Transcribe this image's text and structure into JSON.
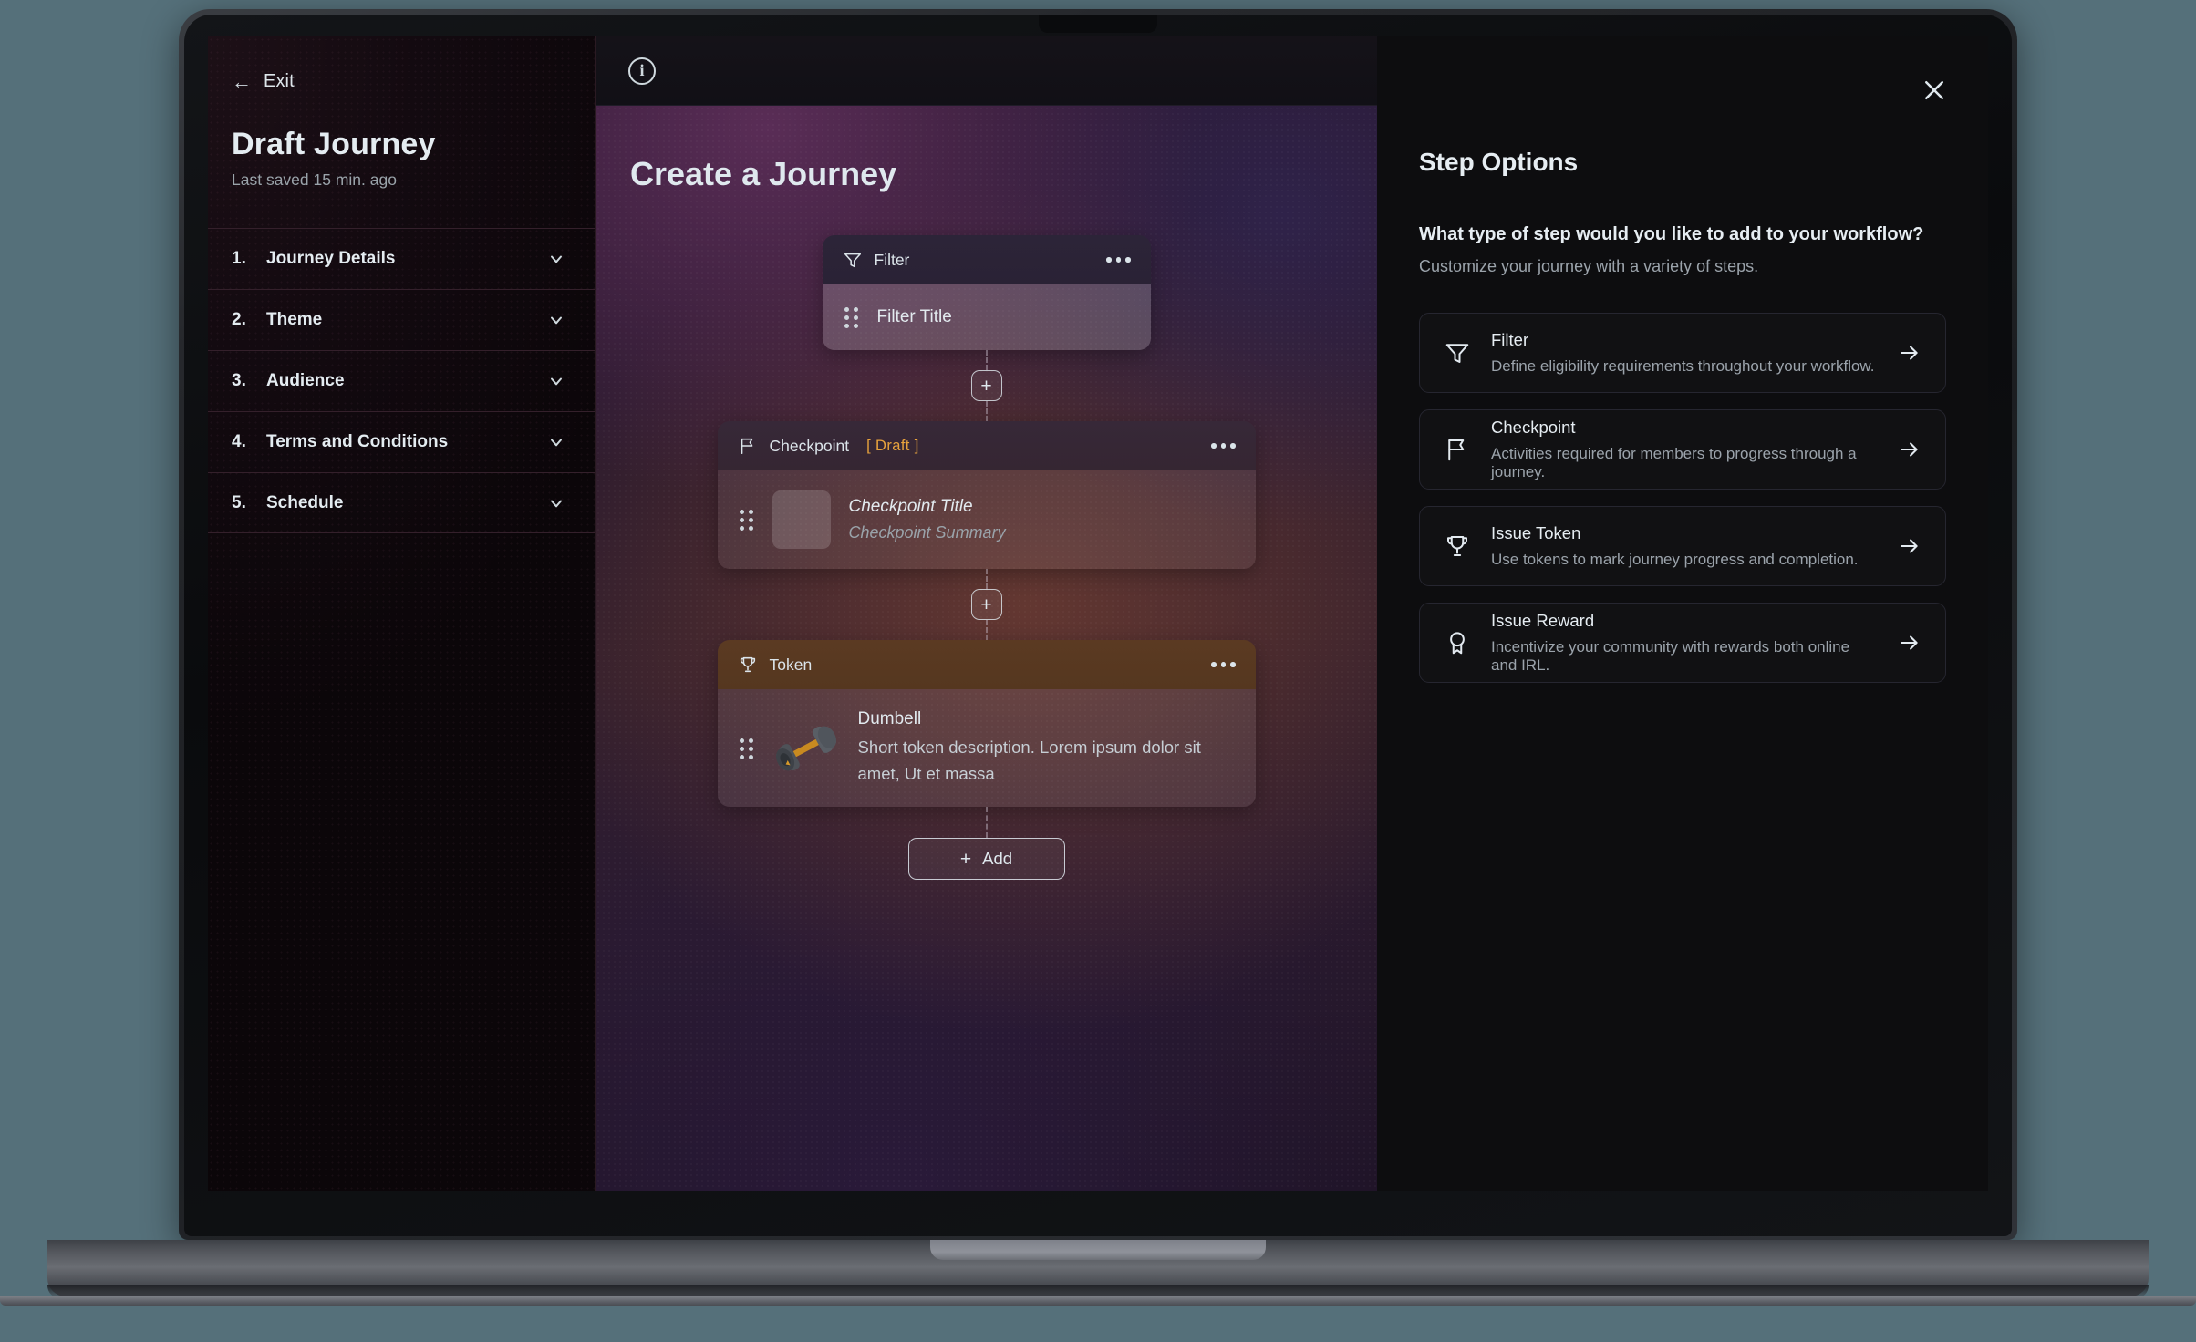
{
  "sidebar": {
    "exit_label": "Exit",
    "title": "Draft Journey",
    "last_saved": "Last saved 15 min. ago",
    "items": [
      {
        "num": "1.",
        "label": "Journey Details"
      },
      {
        "num": "2.",
        "label": "Theme"
      },
      {
        "num": "3.",
        "label": "Audience"
      },
      {
        "num": "4.",
        "label": "Terms and Conditions"
      },
      {
        "num": "5.",
        "label": "Schedule"
      }
    ]
  },
  "canvas": {
    "title": "Create a Journey",
    "add_button": "Add",
    "plus_label": "+",
    "steps": [
      {
        "kind": "filter",
        "head_label": "Filter",
        "badge": "",
        "item_title": "Filter Title"
      },
      {
        "kind": "checkpoint",
        "head_label": "Checkpoint",
        "badge": "[ Draft ]",
        "item_title": "Checkpoint Title",
        "item_sub": "Checkpoint Summary"
      },
      {
        "kind": "token",
        "head_label": "Token",
        "badge": "",
        "item_title": "Dumbell",
        "item_sub": "Short token description. Lorem ipsum dolor sit amet, Ut et massa"
      }
    ]
  },
  "right_panel": {
    "title": "Step Options",
    "question": "What type of step would you like to add to your workflow?",
    "subtitle": "Customize your journey with a variety of steps.",
    "options": [
      {
        "name": "Filter",
        "desc": "Define eligibility requirements throughout your workflow."
      },
      {
        "name": "Checkpoint",
        "desc": "Activities required for members to progress through a journey."
      },
      {
        "name": "Issue Token",
        "desc": "Use tokens to mark journey progress and completion."
      },
      {
        "name": "Issue Reward",
        "desc": "Incentivize your community with rewards both online and IRL."
      }
    ]
  },
  "colors": {
    "draft_badge": "#e8a33d",
    "token_header": "#5b3a22",
    "panel_bg": "#0d0d0f"
  }
}
